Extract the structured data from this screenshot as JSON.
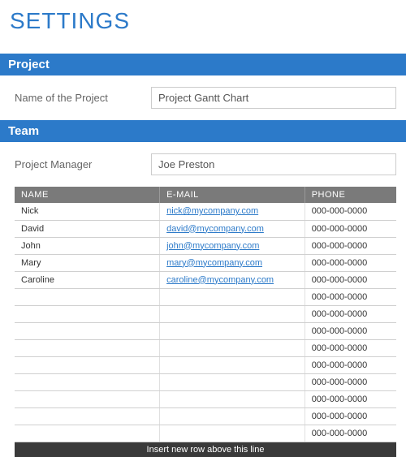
{
  "title": "SETTINGS",
  "sections": {
    "project": {
      "header": "Project",
      "field_label": "Name of the Project",
      "field_value": "Project Gantt Chart"
    },
    "team": {
      "header": "Team",
      "field_label": "Project Manager",
      "field_value": "Joe Preston",
      "columns": {
        "name": "NAME",
        "email": "E-MAIL",
        "phone": "PHONE"
      },
      "rows": [
        {
          "name": "Nick",
          "email": "nick@mycompany.com",
          "phone": "000-000-0000"
        },
        {
          "name": "David",
          "email": "david@mycompany.com",
          "phone": "000-000-0000"
        },
        {
          "name": "John",
          "email": "john@mycompany.com",
          "phone": "000-000-0000"
        },
        {
          "name": "Mary",
          "email": "mary@mycompany.com",
          "phone": "000-000-0000"
        },
        {
          "name": "Caroline",
          "email": "caroline@mycompany.com",
          "phone": "000-000-0000"
        },
        {
          "name": "",
          "email": "",
          "phone": "000-000-0000"
        },
        {
          "name": "",
          "email": "",
          "phone": "000-000-0000"
        },
        {
          "name": "",
          "email": "",
          "phone": "000-000-0000"
        },
        {
          "name": "",
          "email": "",
          "phone": "000-000-0000"
        },
        {
          "name": "",
          "email": "",
          "phone": "000-000-0000"
        },
        {
          "name": "",
          "email": "",
          "phone": "000-000-0000"
        },
        {
          "name": "",
          "email": "",
          "phone": "000-000-0000"
        },
        {
          "name": "",
          "email": "",
          "phone": "000-000-0000"
        },
        {
          "name": "",
          "email": "",
          "phone": "000-000-0000"
        }
      ],
      "footer_text": "Insert new row above this line"
    }
  }
}
